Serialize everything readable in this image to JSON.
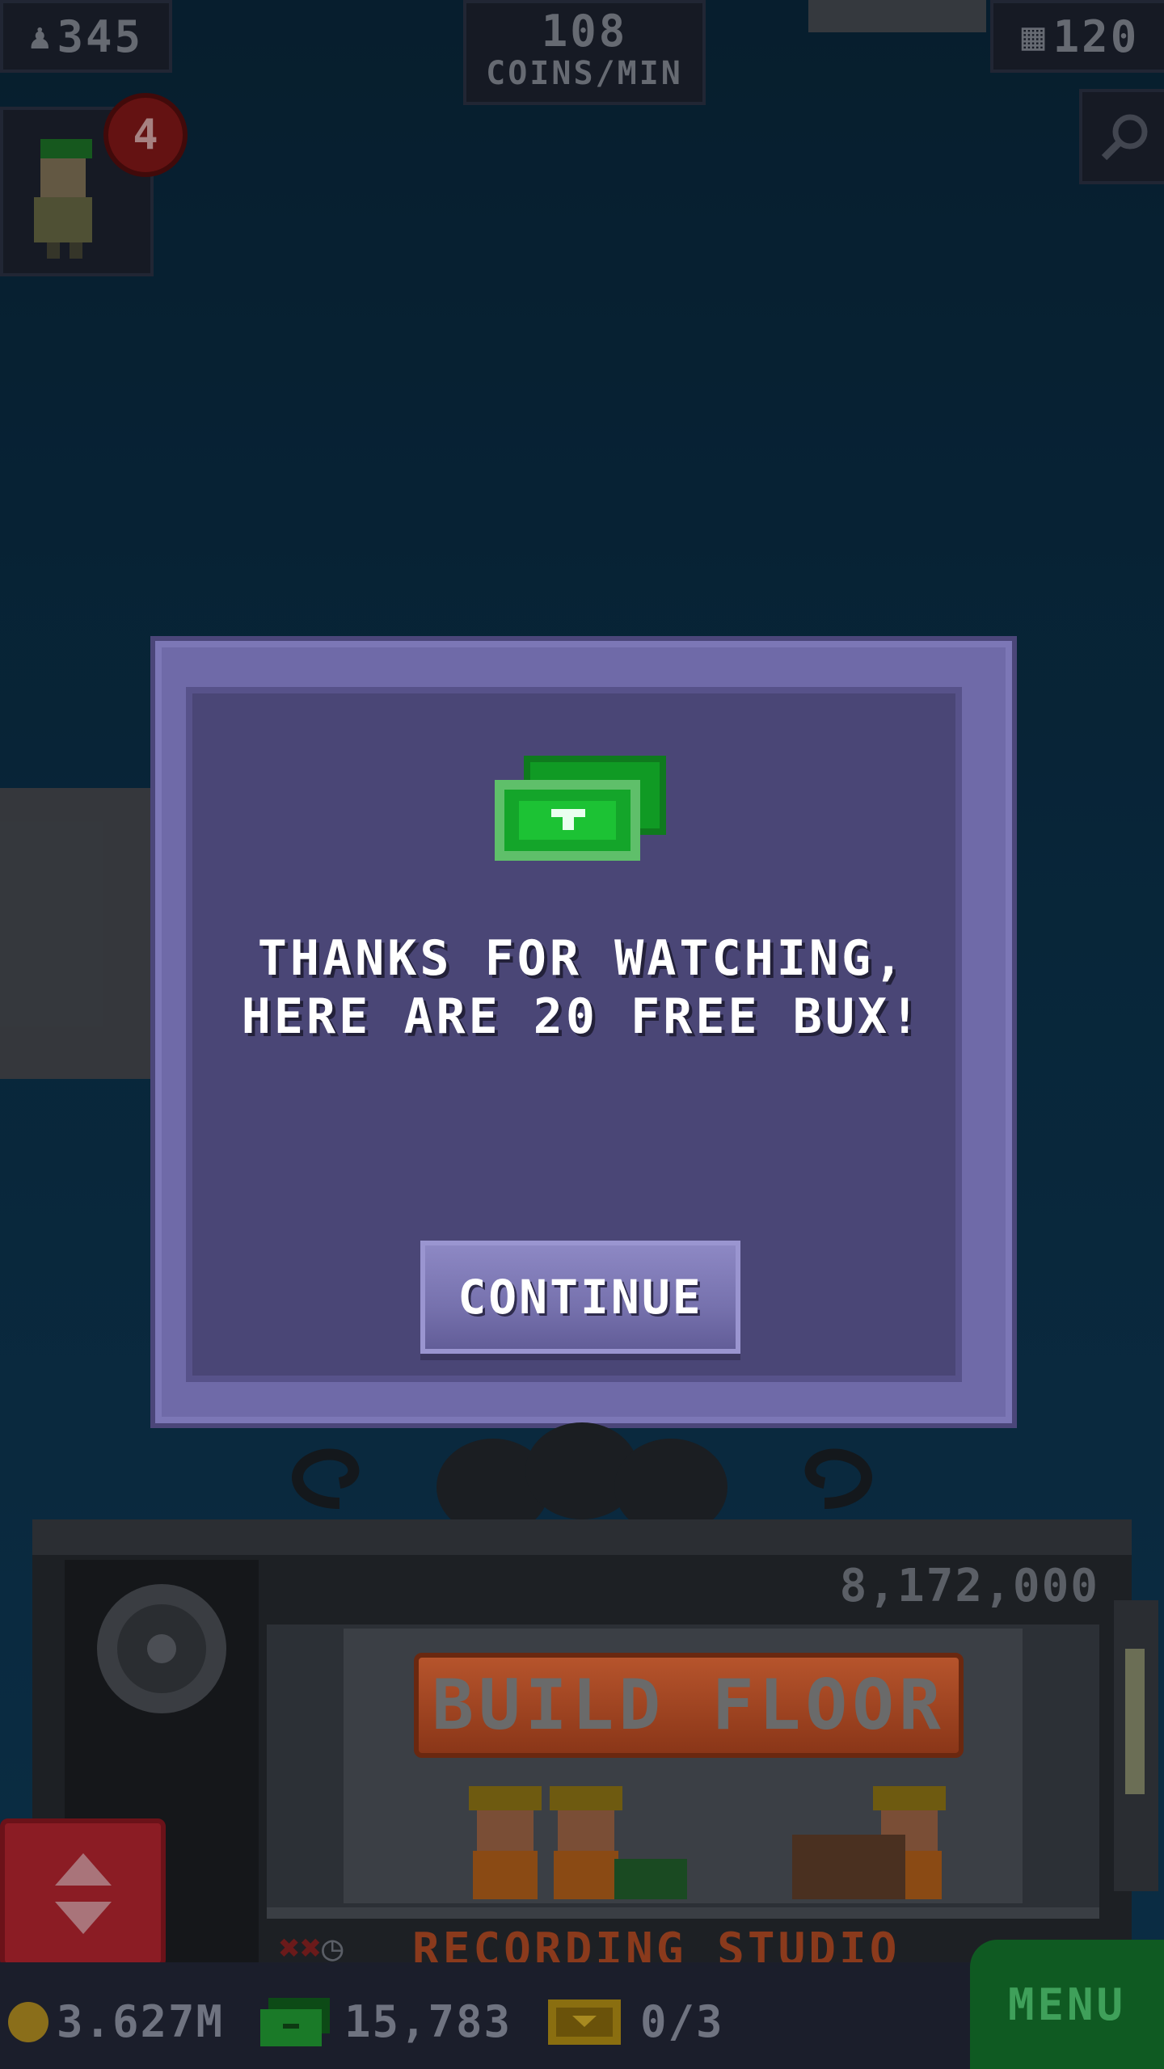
{
  "hud": {
    "population": "345",
    "coins_rate_value": "108",
    "coins_rate_unit": "COINS/MIN",
    "floors": "120",
    "notification_count": "4"
  },
  "dialog": {
    "line1": "THANKS FOR WATCHING,",
    "line2": "HERE ARE 20 FREE BUX!",
    "continue_label": "CONTINUE"
  },
  "tower": {
    "build_floor_label": "BUILD FLOOR",
    "build_cost": "8,172,000",
    "floor_name": "RECORDING STUDIO"
  },
  "bottom_bar": {
    "coins": "3.627M",
    "bux": "15,783",
    "tickets": "0/3",
    "menu_label": "MENU"
  },
  "colors": {
    "sky": "#0b2d44",
    "dialog": "#4a4676",
    "button": "#7671ad",
    "bux_green": "#1aa82a"
  }
}
